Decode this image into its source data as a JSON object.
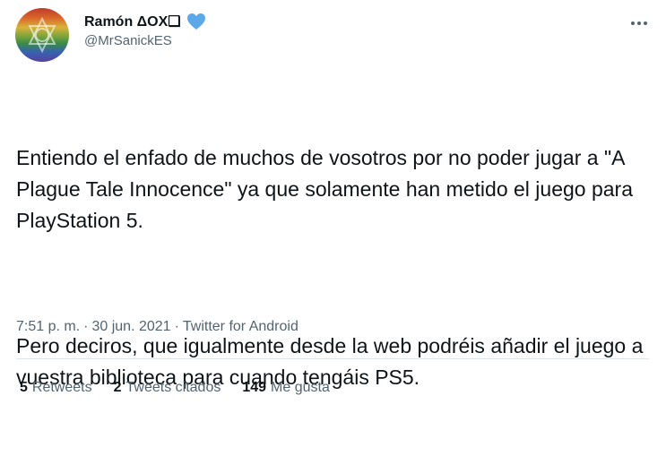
{
  "author": {
    "display_name": "Ramón ΔOX❑",
    "handle": "@MrSanickES",
    "avatar_icon": "rainbow-avatar",
    "badge_icon": "blue-heart-icon"
  },
  "tweet": {
    "paragraphs": [
      "Entiendo el enfado de muchos de vosotros por no poder jugar a \"A Plague Tale Innocence\" ya que solamente han metido el juego para PlayStation 5.",
      "Pero deciros, que igualmente desde la web podréis añadir el juego a vuestra biblioteca para cuando tengáis PS5."
    ]
  },
  "meta": {
    "time": "7:51 p. m.",
    "separator": "·",
    "date": "30 jun. 2021",
    "source": "Twitter for Android"
  },
  "stats": {
    "retweets": {
      "count": "5",
      "label": "Retweets"
    },
    "quotes": {
      "count": "2",
      "label": "Tweets citados"
    },
    "likes": {
      "count": "149",
      "label": "Me gusta"
    }
  },
  "colors": {
    "text": "#0f1419",
    "secondary": "#536471",
    "divider": "#dfe4e8",
    "heart": "#5da8e8"
  }
}
